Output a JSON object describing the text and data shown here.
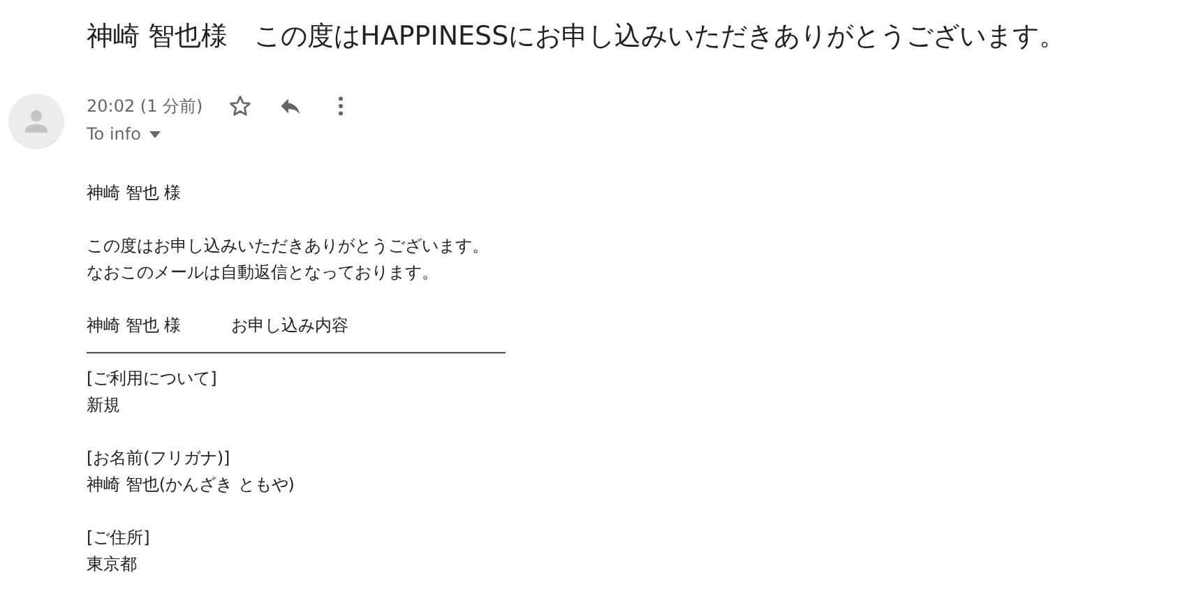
{
  "subject": "神崎 智也様　この度はHAPPINESSにお申し込みいただきありがとうございます。",
  "message": {
    "time": "20:02 (1 分前)",
    "recipient": "To info",
    "starred": false
  },
  "body": [
    [
      "神崎 智也 様"
    ],
    [
      "この度はお申し込みいただきありがとうございます。",
      "なおこのメールは自動返信となっております。"
    ],
    [
      "神崎 智也 様　　　お申し込み内容",
      "―――――――――――――――――――――――――",
      "[ご利用について]",
      "新規"
    ],
    [
      "[お名前(フリガナ)]",
      "神崎 智也(かんざき ともや)"
    ],
    [
      "[ご住所]",
      "東京都"
    ]
  ]
}
